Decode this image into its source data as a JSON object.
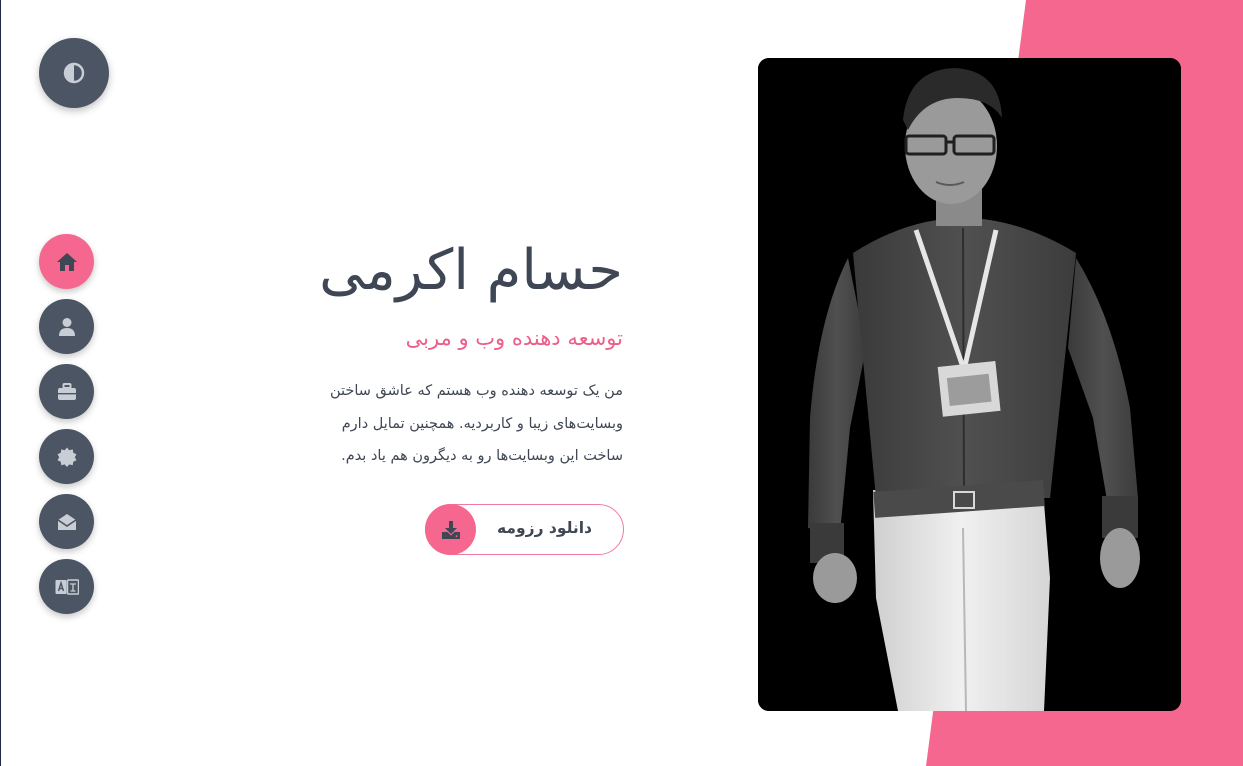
{
  "colors": {
    "accent": "#f5678f",
    "dark": "#4b5563",
    "text": "#3f4754"
  },
  "theme_toggle": {
    "icon": "contrast-icon"
  },
  "nav": [
    {
      "icon": "home-icon",
      "active": true
    },
    {
      "icon": "user-icon",
      "active": false
    },
    {
      "icon": "briefcase-icon",
      "active": false
    },
    {
      "icon": "badge-icon",
      "active": false
    },
    {
      "icon": "envelope-open-icon",
      "active": false
    },
    {
      "icon": "language-icon",
      "active": false
    }
  ],
  "hero": {
    "name": "حسام اکرمی",
    "role": "توسعه دهنده وب و مربی",
    "bio_lines": [
      "من یک توسعه دهنده وب هستم که عاشق ساختن",
      "وبسایت‌های زیبا و کاربردیه. همچنین تمایل دارم",
      "ساخت این وبسایت‌ها رو به دیگرون هم یاد بدم."
    ],
    "cv_button": "دانلود رزومه"
  }
}
